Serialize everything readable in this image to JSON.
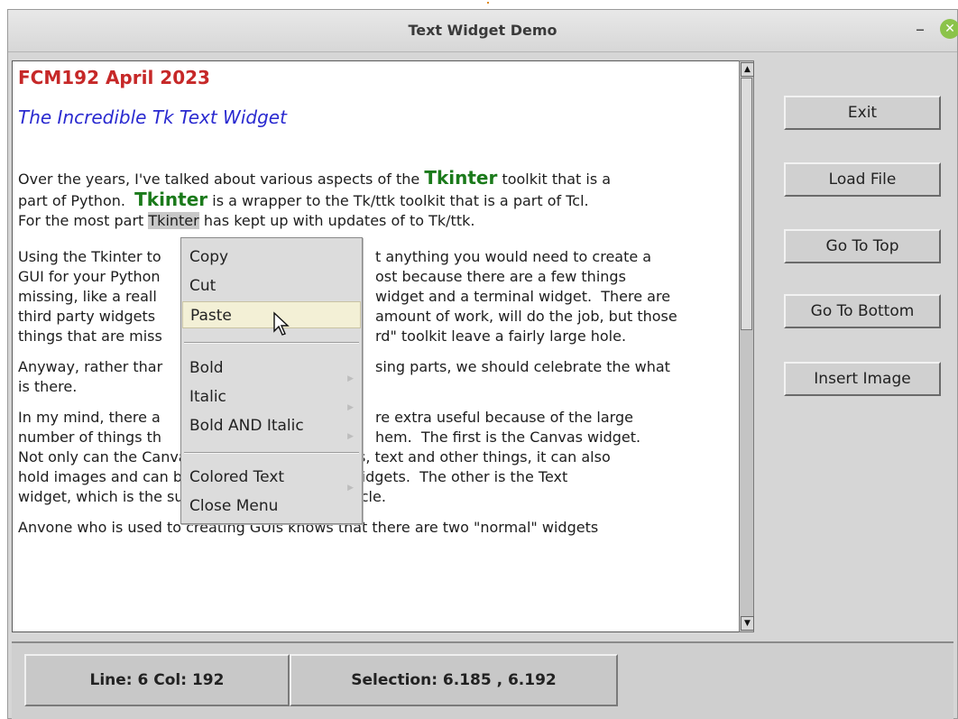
{
  "window": {
    "title": "Text Widget Demo"
  },
  "text": {
    "heading": "FCM192 April 2023",
    "subheading": "The Incredible Tk Text Widget",
    "p1": {
      "l1_a": "Over the years, I've talked about various aspects of the ",
      "l1_tk": "Tkinter",
      "l1_b": " toolkit that is a",
      "l2_a": "part of Python.  ",
      "l2_tk": "Tkinter",
      "l2_b": " is a wrapper to the Tk/ttk toolkit that is a part of Tcl.",
      "l3_a": "For the most part ",
      "l3_sel": "Tkinter",
      "l3_b": " has kept up with updates of to Tk/ttk."
    },
    "p2": [
      "Using the Tkinter to",
      "GUI for your Python",
      "missing, like a reall",
      "third party widgets",
      "things that are miss"
    ],
    "p2_right": [
      "t anything you would need to create a",
      "ost because there are a few things",
      "widget and a terminal widget.  There are",
      "amount of work, will do the job, but those",
      "rd\" toolkit leave a fairly large hole."
    ],
    "p3_left": "Anyway, rather thar",
    "p3_right": "sing parts, we should celebrate the what",
    "p3_l2": "is there.",
    "p4_l1_left": "In my mind, there a",
    "p4_l1_right": "re extra useful because of the large",
    "p4_l2_left": "number of things th",
    "p4_l2_right": "hem.  The first is the Canvas widget.",
    "p4_l3": "Not only can the Canvas widget draw lines, arcs, text and other things, it can also",
    "p4_l4": "hold images and can be a container for other widgets.  The other is the Text",
    "p4_l5": "widget, which is the subject of this month's article.",
    "p5": "Anvone who is used to creating GUIs knows that there are two \"normal\" widgets"
  },
  "buttons": {
    "exit": "Exit",
    "load_file": "Load File",
    "go_top": "Go To Top",
    "go_bottom": "Go To Bottom",
    "insert_image": "Insert Image"
  },
  "status": {
    "line_col": "Line: 6 Col: 192",
    "selection": "Selection: 6.185 , 6.192"
  },
  "context_menu": {
    "copy": "Copy",
    "cut": "Cut",
    "paste": "Paste",
    "bold": "Bold",
    "italic": "Italic",
    "bold_italic": "Bold AND Italic",
    "colored_text": "Colored Text",
    "close_menu": "Close Menu"
  },
  "colors": {
    "heading": "#c62828",
    "subheading": "#2a2ad0",
    "tkinter_tag": "#1b7a1b",
    "menu_active": "#f3f0d6"
  }
}
